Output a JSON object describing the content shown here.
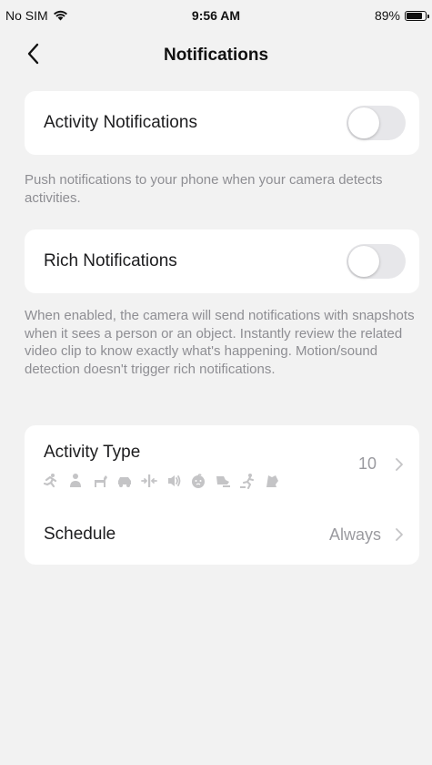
{
  "status_bar": {
    "carrier": "No SIM",
    "time": "9:56 AM",
    "battery": "89%",
    "battery_level": 0.89
  },
  "nav": {
    "title": "Notifications"
  },
  "activity_notifications": {
    "label": "Activity Notifications",
    "enabled": false,
    "description": "Push notifications to your phone when your camera detects activities."
  },
  "rich_notifications": {
    "label": "Rich Notifications",
    "enabled": false,
    "description": "When enabled, the camera will send notifications with snapshots when it sees a person or an object. Instantly review the related video clip to know exactly what's happening. Motion/sound detection doesn't trigger rich notifications."
  },
  "activity_type": {
    "label": "Activity Type",
    "count": "10",
    "icons": [
      "motion-icon",
      "person-icon",
      "pet-icon",
      "vehicle-icon",
      "line-crossing-icon",
      "sound-icon",
      "baby-cry-icon",
      "area-intrusion-icon",
      "loitering-icon",
      "object-detection-icon"
    ]
  },
  "schedule": {
    "label": "Schedule",
    "value": "Always"
  },
  "colors": {
    "background": "#f2f2f2",
    "card": "#ffffff",
    "toggle_off": "#e7e7ea",
    "secondary_text": "#8e8e93",
    "icon_gray": "#c4c4c6"
  }
}
